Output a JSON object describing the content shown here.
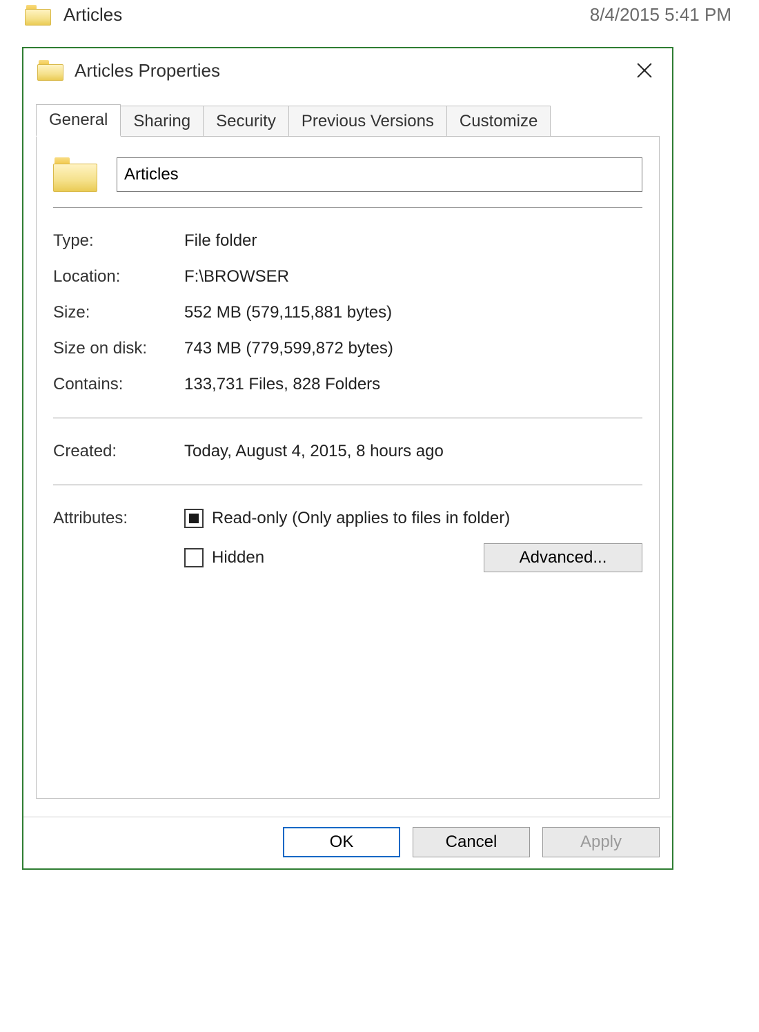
{
  "explorer_row": {
    "folder_name": "Articles",
    "date": "8/4/2015 5:41 PM"
  },
  "dialog": {
    "title": "Articles Properties",
    "close_label": "Close",
    "tabs": [
      {
        "label": "General"
      },
      {
        "label": "Sharing"
      },
      {
        "label": "Security"
      },
      {
        "label": "Previous Versions"
      },
      {
        "label": "Customize"
      }
    ],
    "general": {
      "name_value": "Articles",
      "type_label": "Type:",
      "type_value": "File folder",
      "location_label": "Location:",
      "location_value": "F:\\BROWSER",
      "size_label": "Size:",
      "size_value": "552 MB (579,115,881 bytes)",
      "size_on_disk_label": "Size on disk:",
      "size_on_disk_value": "743 MB (779,599,872 bytes)",
      "contains_label": "Contains:",
      "contains_value": "133,731 Files, 828 Folders",
      "created_label": "Created:",
      "created_value": "Today, August 4, 2015, 8 hours ago",
      "attributes_label": "Attributes:",
      "readonly_label": "Read-only (Only applies to files in folder)",
      "readonly_state": "indeterminate",
      "hidden_label": "Hidden",
      "hidden_state": "unchecked",
      "advanced_label": "Advanced..."
    },
    "buttons": {
      "ok": "OK",
      "cancel": "Cancel",
      "apply": "Apply"
    }
  }
}
